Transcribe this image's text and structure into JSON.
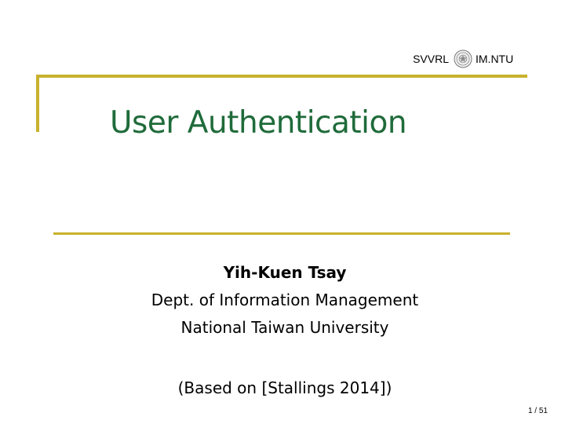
{
  "header": {
    "lab": "SVVRL",
    "institution": "IM.NTU",
    "seal_icon": "university-seal-icon"
  },
  "slide": {
    "title": "User Authentication",
    "author": {
      "name": "Yih-Kuen Tsay",
      "department": "Dept. of Information Management",
      "university": "National Taiwan University"
    },
    "source_note": "(Based on [Stallings 2014])"
  },
  "footer": {
    "page": "1 / 51"
  },
  "colors": {
    "title": "#1f6b3a",
    "accent_line": "#c8b22e",
    "text": "#000000"
  }
}
